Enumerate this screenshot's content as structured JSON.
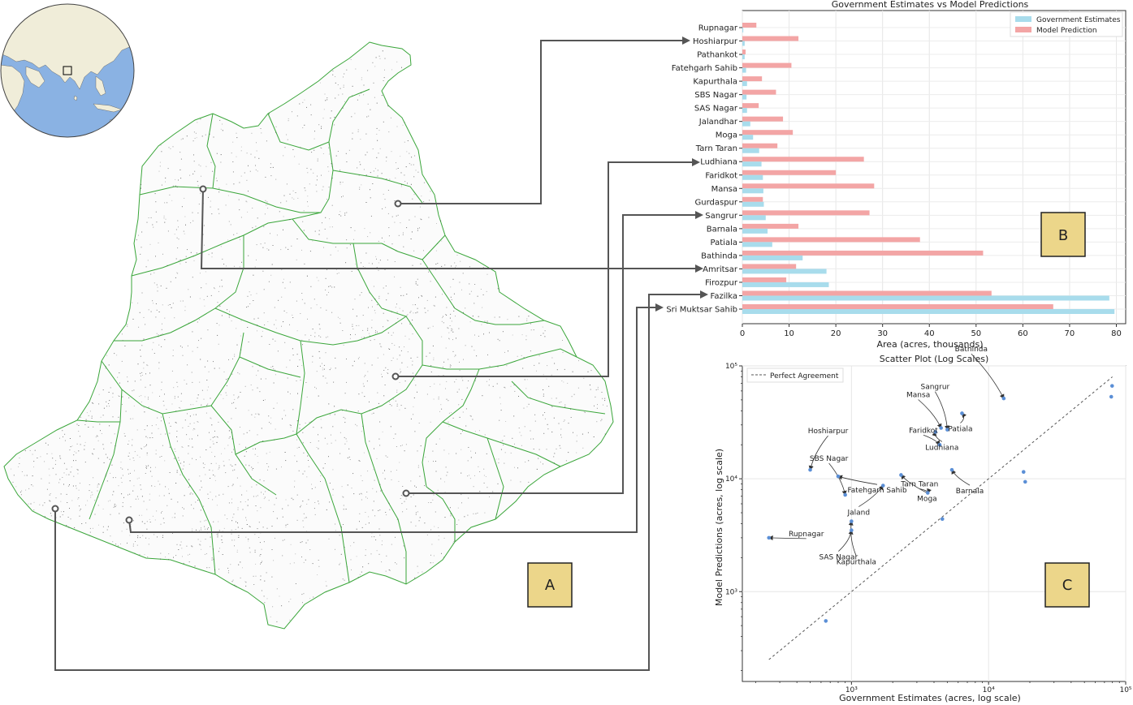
{
  "panels": {
    "map_label": "A",
    "bar_label": "B",
    "scatter_label": "C",
    "panel_box_color": "#ecd68a"
  },
  "map": {
    "boundary_color": "#3aa63a",
    "globe_land": "#f0edd9",
    "globe_ocean": "#8ab2e3"
  },
  "colors": {
    "government": "#a8dcec",
    "model": "#f3a5a5",
    "scatter_point": "#5b8fd6",
    "arrow": "#555555"
  },
  "chart_data": [
    {
      "type": "bar",
      "orientation": "horizontal",
      "title": "Government Estimates vs Model Predictions",
      "xlabel": "Area (acres, thousands)",
      "ylabel": "",
      "xlim": [
        0,
        82
      ],
      "xticks": [
        0,
        10,
        20,
        30,
        40,
        50,
        60,
        70,
        80
      ],
      "legend_position": "top-right",
      "grid": true,
      "categories": [
        "Rupnagar",
        "Hoshiarpur",
        "Pathankot",
        "Fatehgarh Sahib",
        "Kapurthala",
        "SBS Nagar",
        "SAS Nagar",
        "Jalandhar",
        "Moga",
        "Tarn Taran",
        "Ludhiana",
        "Faridkot",
        "Mansa",
        "Gurdaspur",
        "Sangrur",
        "Barnala",
        "Patiala",
        "Bathinda",
        "Amritsar",
        "Firozpur",
        "Fazilka",
        "Sri Muktsar Sahib"
      ],
      "series": [
        {
          "name": "Government Estimates",
          "values": [
            0.2,
            0.5,
            0.5,
            0.8,
            1.0,
            0.9,
            1.0,
            1.7,
            2.3,
            3.6,
            4.1,
            4.4,
            4.5,
            4.6,
            5.0,
            5.4,
            6.4,
            12.9,
            18.0,
            18.5,
            78.5,
            79.6
          ]
        },
        {
          "name": "Model Prediction",
          "values": [
            3.0,
            12.0,
            0.7,
            10.5,
            4.2,
            7.2,
            3.5,
            8.7,
            10.8,
            7.5,
            26.0,
            20.0,
            28.2,
            4.4,
            27.2,
            12.0,
            38.0,
            51.5,
            11.5,
            9.4,
            53.3,
            66.5
          ]
        }
      ]
    },
    {
      "type": "scatter",
      "title": "Scatter Plot (Log Scales)",
      "xlabel": "Government Estimates (acres, log scale)",
      "ylabel": "Model Predictions (acres, log scale)",
      "x_scale": "log",
      "y_scale": "log",
      "xlim": [
        160,
        100000
      ],
      "ylim": [
        160,
        100000
      ],
      "x_tick_labels": [
        "10³",
        "10⁴",
        "10⁵"
      ],
      "y_tick_labels": [
        "10³",
        "10⁴",
        "10⁵"
      ],
      "grid": true,
      "legend_position": "top-left",
      "reference_line": {
        "name": "Perfect Agreement",
        "from": 250,
        "to": 80000
      },
      "points": [
        {
          "label": "Rupnagar",
          "x": 250,
          "y": 3000
        },
        {
          "label": "Hoshiarpur",
          "x": 500,
          "y": 12000
        },
        {
          "label": "SBS Nagar",
          "x": 900,
          "y": 7200
        },
        {
          "label": "SAS Nagar",
          "x": 1000,
          "y": 3500
        },
        {
          "label": "Pathankot",
          "x": 650,
          "y": 550
        },
        {
          "label": "Fatehgarh Sahib",
          "x": 800,
          "y": 10500
        },
        {
          "label": "Jalandhar",
          "x": 1700,
          "y": 8700
        },
        {
          "label": "Kapurthala",
          "x": 1000,
          "y": 4200
        },
        {
          "label": "Moga",
          "x": 2300,
          "y": 10800
        },
        {
          "label": "Tarn Taran",
          "x": 3600,
          "y": 7500
        },
        {
          "label": "Ludhiana",
          "x": 4100,
          "y": 26000
        },
        {
          "label": "Faridkot",
          "x": 4400,
          "y": 20000
        },
        {
          "label": "Mansa",
          "x": 4500,
          "y": 28200
        },
        {
          "label": "Gurdaspur",
          "x": 4600,
          "y": 4400
        },
        {
          "label": "Sangrur",
          "x": 5000,
          "y": 27200
        },
        {
          "label": "Barnala",
          "x": 5400,
          "y": 12000
        },
        {
          "label": "Patiala",
          "x": 6400,
          "y": 38000
        },
        {
          "label": "Bathinda",
          "x": 12900,
          "y": 51500
        },
        {
          "label": "Amritsar",
          "x": 18000,
          "y": 11500
        },
        {
          "label": "Firozpur",
          "x": 18500,
          "y": 9400
        },
        {
          "label": "Fazilka",
          "x": 78500,
          "y": 53300
        },
        {
          "label": "Sri Muktsar Sahib",
          "x": 79600,
          "y": 66500
        }
      ],
      "annotated_labels": [
        "Bathinda",
        "Sangrur",
        "Mansa",
        "Faridkot",
        "Ludhiana",
        "Patiala",
        "Hoshiarpur",
        "SBS Nagar",
        "Tarn Taran",
        "Fatehgarh Sahib",
        "Moga",
        "Barnala",
        "Jalandhar",
        "Kapurthala",
        "Rupnagar",
        "SAS Nagar"
      ],
      "annotation_display": {
        "Jalandhar": "Jaland"
      }
    }
  ]
}
